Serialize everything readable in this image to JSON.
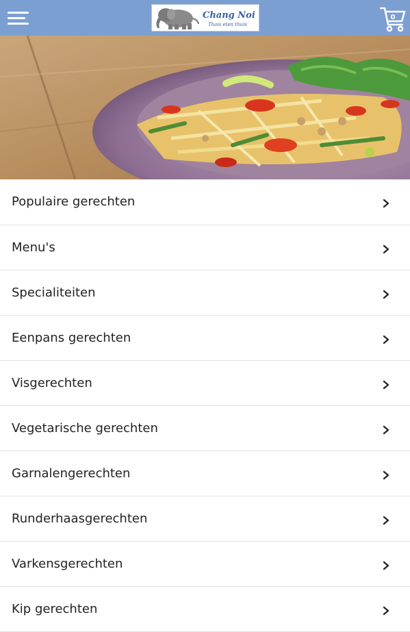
{
  "header": {
    "logo": {
      "name": "Chang Noi",
      "tagline": "Thais eten thuis",
      "icon": "elephant-logo"
    },
    "menu_icon": "hamburger-menu-icon",
    "cart": {
      "icon": "shopping-cart-icon",
      "count": "0"
    },
    "colors": {
      "bar": "#7c9fd2",
      "logo_text": "#3a5ea6"
    }
  },
  "hero": {
    "image": "papaya salad dish on purple plate over wooden table"
  },
  "menu": {
    "chevron_icon": "chevron-right-icon",
    "items": [
      {
        "label": "Populaire gerechten"
      },
      {
        "label": "Menu's"
      },
      {
        "label": "Specialiteiten"
      },
      {
        "label": "Eenpans gerechten"
      },
      {
        "label": "Visgerechten"
      },
      {
        "label": "Vegetarische gerechten"
      },
      {
        "label": "Garnalengerechten"
      },
      {
        "label": "Runderhaasgerechten"
      },
      {
        "label": "Varkensgerechten"
      },
      {
        "label": "Kip gerechten"
      }
    ]
  }
}
